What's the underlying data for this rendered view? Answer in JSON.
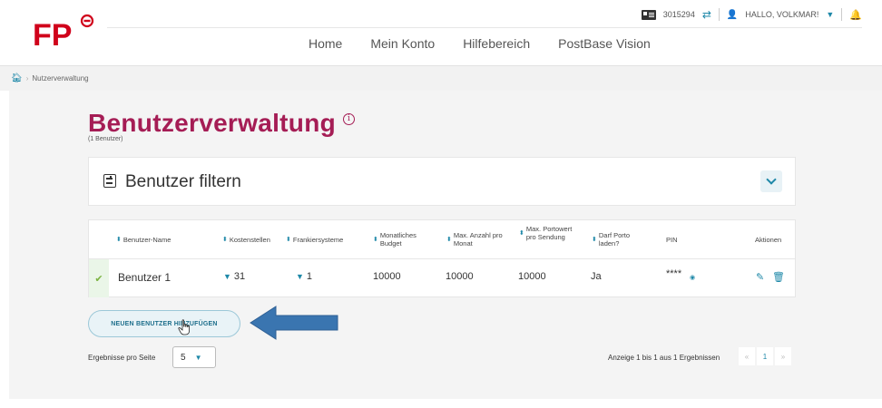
{
  "header": {
    "customer_id": "3015294",
    "greeting": "HALLO, VOLKMAR!",
    "nav": [
      "Home",
      "Mein Konto",
      "Hilfebereich",
      "PostBase Vision"
    ]
  },
  "breadcrumb": {
    "current": "Nutzerverwaltung"
  },
  "page": {
    "title": "Benutzerverwaltung",
    "subtitle": "(1 Benutzer)",
    "info_glyph": "i"
  },
  "filter": {
    "title": "Benutzer filtern"
  },
  "table": {
    "headers": {
      "name": "Benutzer-Name",
      "cost_centers": "Kostenstellen",
      "franking_systems": "Frankiersysteme",
      "monthly_budget": "Monatliches Budget",
      "max_count": "Max. Anzahl pro Monat",
      "max_postage": "Max. Portowert pro Sendung",
      "may_load_postage": "Darf Porto laden?",
      "pin": "PIN",
      "actions": "Aktionen"
    },
    "rows": [
      {
        "name": "Benutzer 1",
        "cost_centers": "31",
        "franking_systems": "1",
        "monthly_budget": "10000",
        "max_count": "10000",
        "max_postage": "10000",
        "may_load_postage": "Ja",
        "pin": "****"
      }
    ]
  },
  "add_button": {
    "label": "NEUEN BENUTZER HINZUFÜGEN"
  },
  "pagination": {
    "per_page_label": "Ergebnisse pro Seite",
    "per_page_value": "5",
    "results_text": "Anzeige 1 bis 1 aus 1 Ergebnissen",
    "first": "«",
    "current_page": "1",
    "next": "»"
  },
  "colors": {
    "brand": "#a51d55",
    "accent": "#1e88a8",
    "annotation_arrow": "#3a75b0"
  }
}
